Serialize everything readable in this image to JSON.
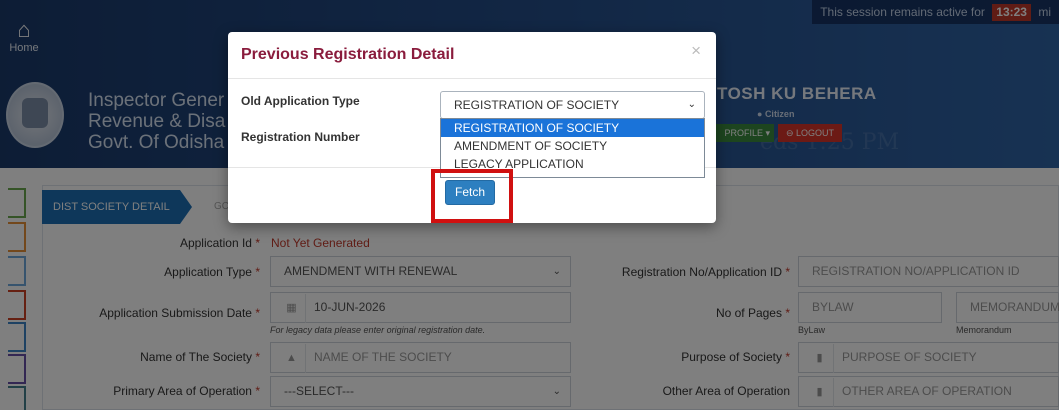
{
  "header": {
    "home_label": "Home",
    "org_lines": [
      "Inspector Gener",
      "Revenue & Disa",
      "Govt. Of Odisha"
    ],
    "session_text": "This session remains active for",
    "session_time": "13:23",
    "session_unit": "mi",
    "user_name": "TOSH KU BEHERA",
    "user_role": "Citizen",
    "profile_label": "PROFILE ▾",
    "logout_label": "⊖ LOGOUT",
    "bg_clock": "eds 1:25 PM"
  },
  "tabs": {
    "active": "DIST SOCIETY DETAIL",
    "next": "GC"
  },
  "form": {
    "application_id_label": "Application Id",
    "application_id_value": "Not Yet Generated",
    "application_type_label": "Application Type",
    "application_type_value": "AMENDMENT WITH RENEWAL",
    "registration_no_label": "Registration No/Application ID",
    "registration_no_placeholder": "REGISTRATION NO/APPLICATION ID",
    "submission_date_label": "Application Submission Date",
    "submission_date_value": "10-JUN-2026",
    "submission_hint": "For legacy data please enter original registration date.",
    "no_of_pages_label": "No of Pages",
    "bylaw_placeholder": "BYLAW",
    "bylaw_sub": "ByLaw",
    "memorandum_placeholder": "MEMORANDUM",
    "memorandum_sub": "Memorandum",
    "society_name_label": "Name of The Society",
    "society_name_placeholder": "NAME OF THE SOCIETY",
    "purpose_label": "Purpose of Society",
    "purpose_placeholder": "PURPOSE OF SOCIETY",
    "primary_area_label": "Primary Area of Operation",
    "primary_area_value": "---SELECT---",
    "other_area_label": "Other Area of Operation",
    "other_area_placeholder": "OTHER AREA OF OPERATION"
  },
  "modal": {
    "title": "Previous Registration Detail",
    "close": "×",
    "old_app_type_label": "Old Application Type",
    "old_app_type_value": "REGISTRATION OF SOCIETY",
    "registration_number_label": "Registration Number",
    "dropdown_options": [
      "REGISTRATION OF SOCIETY",
      "AMENDMENT OF SOCIETY",
      "LEGACY APPLICATION"
    ],
    "fetch_label": "Fetch"
  },
  "colors": {
    "header_bg": "#234b86",
    "modal_title": "#8a1c3d",
    "primary_button": "#2d7fc0",
    "highlight": "#d01010",
    "required": "#c0392b"
  }
}
